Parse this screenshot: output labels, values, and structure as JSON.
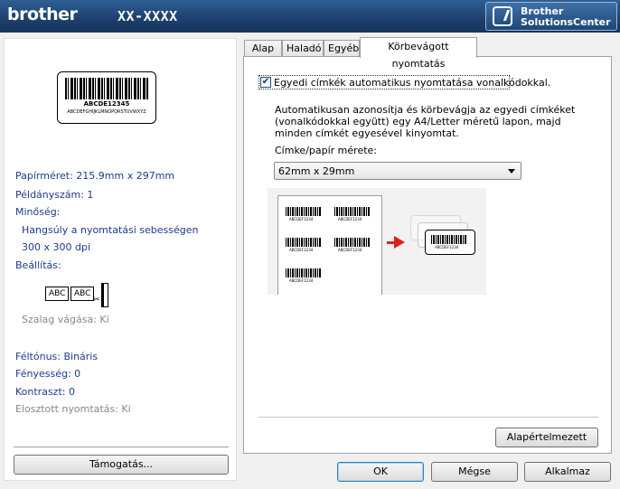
{
  "header": {
    "brand": "brother",
    "model": "XX-XXXX",
    "solutions_center_line1": "Brother",
    "solutions_center_line2": "SolutionsCenter"
  },
  "preview": {
    "label_code": "ABCDE12345",
    "label_alphabet": "ABCDEFGHIJKLMNOPQRSTUVWXYZ",
    "paper_size": "Papírméret: 215.9mm x 297mm",
    "copies": "Példányszám: 1",
    "quality_heading": "Minőség:",
    "quality_value": "Hangsúly a nyomtatási sebességen",
    "resolution": "300 x 300 dpi",
    "settings_heading": "Beállítás:",
    "cut_abc1": "ABC",
    "cut_abc2": "ABC",
    "tape_cut": "Szalag vágása: Ki",
    "halftone": "Féltónus: Bináris",
    "brightness": "Fényesség:   0",
    "contrast": "Kontraszt:   0",
    "distributed": "Elosztott nyomtatás: Ki",
    "support_button": "Támogatás..."
  },
  "tabs": [
    {
      "label": "Alap"
    },
    {
      "label": "Haladó"
    },
    {
      "label": "Egyéb"
    },
    {
      "label": "Körbevágott nyomtatás"
    }
  ],
  "trim": {
    "checkbox_label": "Egyedi címkék automatikus nyomtatása vonalkódokkal.",
    "checkbox_checked": "✔",
    "description": "Automatikusan azonosítja és körbevágja az egyedi címkéket (vonalkódokkal együtt) egy A4/Letter méretű lapon, majd minden címkét egyesével kinyomtat.",
    "size_label": "Címke/papír mérete:",
    "size_value": "62mm x 29mm",
    "illus_code": "ABCDEF1234",
    "defaults_button": "Alapértelmezett"
  },
  "footer": {
    "ok": "OK",
    "cancel": "Mégse",
    "apply": "Alkalmaz"
  }
}
